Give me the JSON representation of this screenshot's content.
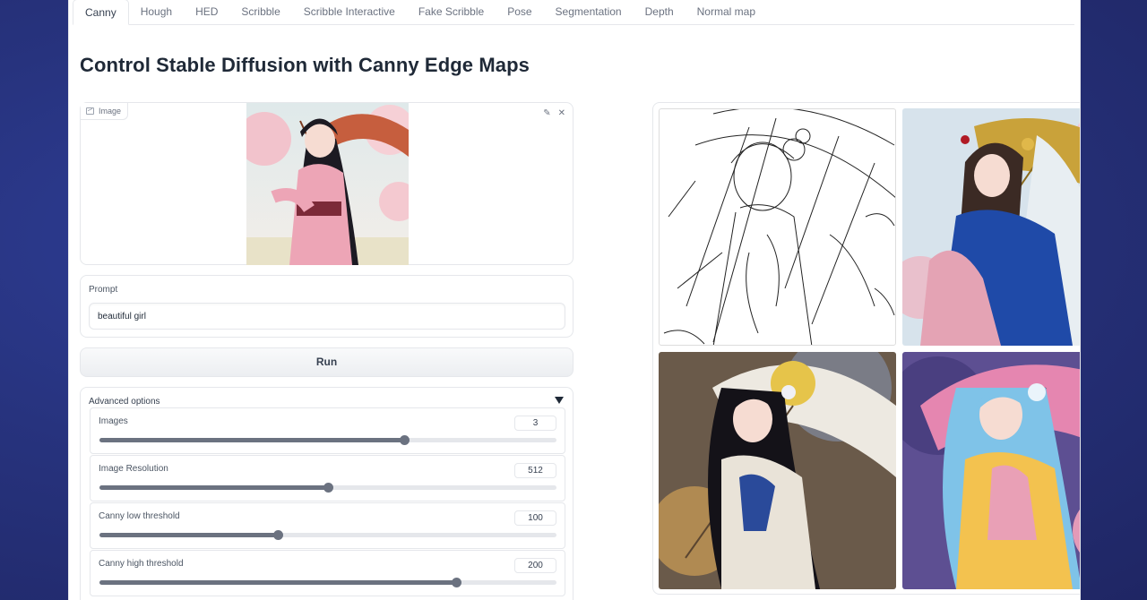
{
  "tabs": [
    {
      "label": "Canny",
      "active": true
    },
    {
      "label": "Hough",
      "active": false
    },
    {
      "label": "HED",
      "active": false
    },
    {
      "label": "Scribble",
      "active": false
    },
    {
      "label": "Scribble Interactive",
      "active": false
    },
    {
      "label": "Fake Scribble",
      "active": false
    },
    {
      "label": "Pose",
      "active": false
    },
    {
      "label": "Segmentation",
      "active": false
    },
    {
      "label": "Depth",
      "active": false
    },
    {
      "label": "Normal map",
      "active": false
    }
  ],
  "page_title": "Control Stable Diffusion with Canny Edge Maps",
  "image_input": {
    "label": "Image",
    "edit_icon": "pencil-icon",
    "clear_icon": "close-icon"
  },
  "prompt": {
    "label": "Prompt",
    "value": "beautiful girl"
  },
  "run_label": "Run",
  "advanced": {
    "label": "Advanced options",
    "sliders": [
      {
        "label": "Images",
        "value": "3",
        "fraction": 0.667
      },
      {
        "label": "Image Resolution",
        "value": "512",
        "fraction": 0.5
      },
      {
        "label": "Canny low threshold",
        "value": "100",
        "fraction": 0.39
      },
      {
        "label": "Canny high threshold",
        "value": "200",
        "fraction": 0.78
      }
    ]
  },
  "colors": {
    "accent": "#6b7280",
    "background": "#27337e",
    "border": "#e5e7eb"
  }
}
